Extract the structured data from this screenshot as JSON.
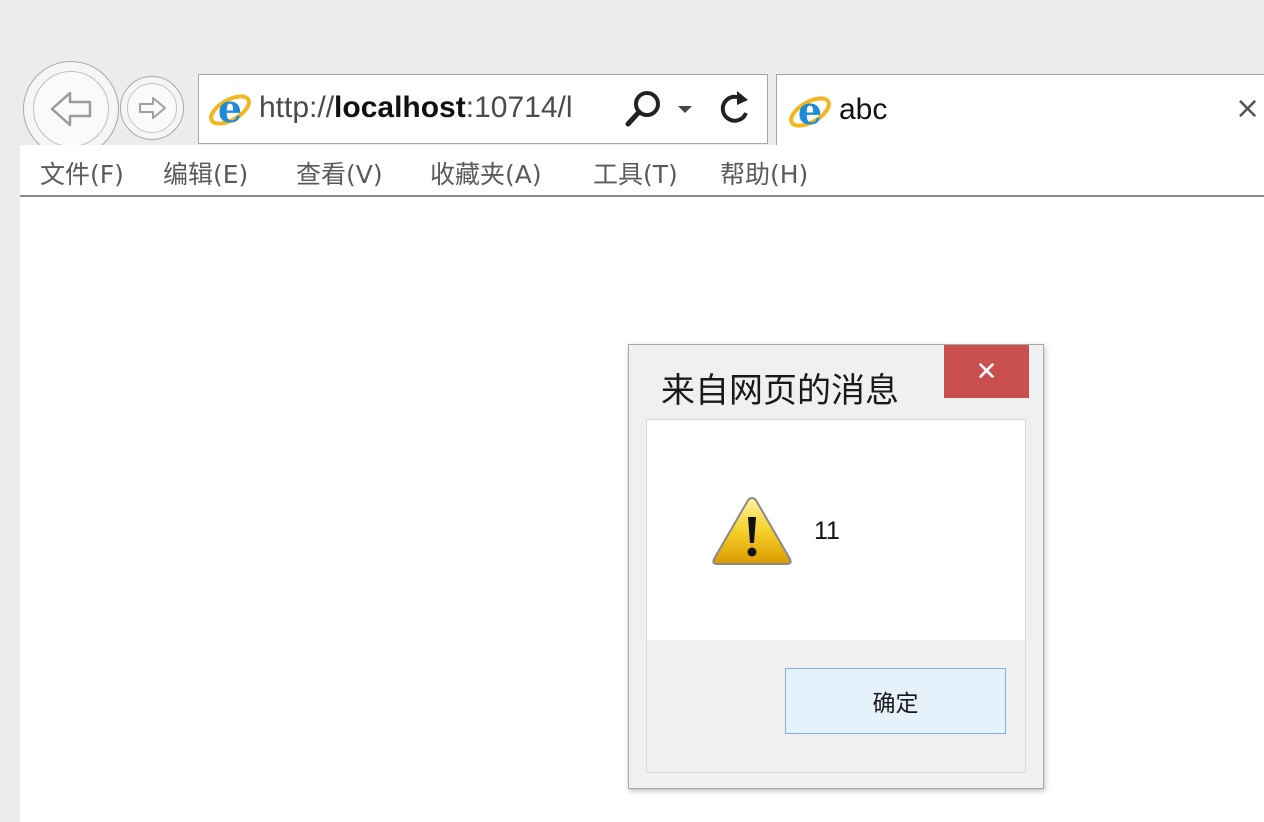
{
  "browser": {
    "address": {
      "scheme": "http://",
      "host": "localhost",
      "rest": ":10714/l"
    },
    "tab": {
      "title": "abc",
      "close_glyph": "×"
    },
    "icons": [
      "back-arrow-icon",
      "forward-arrow-icon",
      "ie-logo-icon",
      "search-icon",
      "dropdown-icon",
      "refresh-icon"
    ]
  },
  "menu": {
    "items": [
      "文件(F)",
      "编辑(E)",
      "查看(V)",
      "收藏夹(A)",
      "工具(T)",
      "帮助(H)"
    ]
  },
  "dialog": {
    "title": "来自网页的消息",
    "close_glyph": "✕",
    "message": "11",
    "ok_label": "确定",
    "icon": "warning-icon",
    "close_color": "#c9504f"
  }
}
